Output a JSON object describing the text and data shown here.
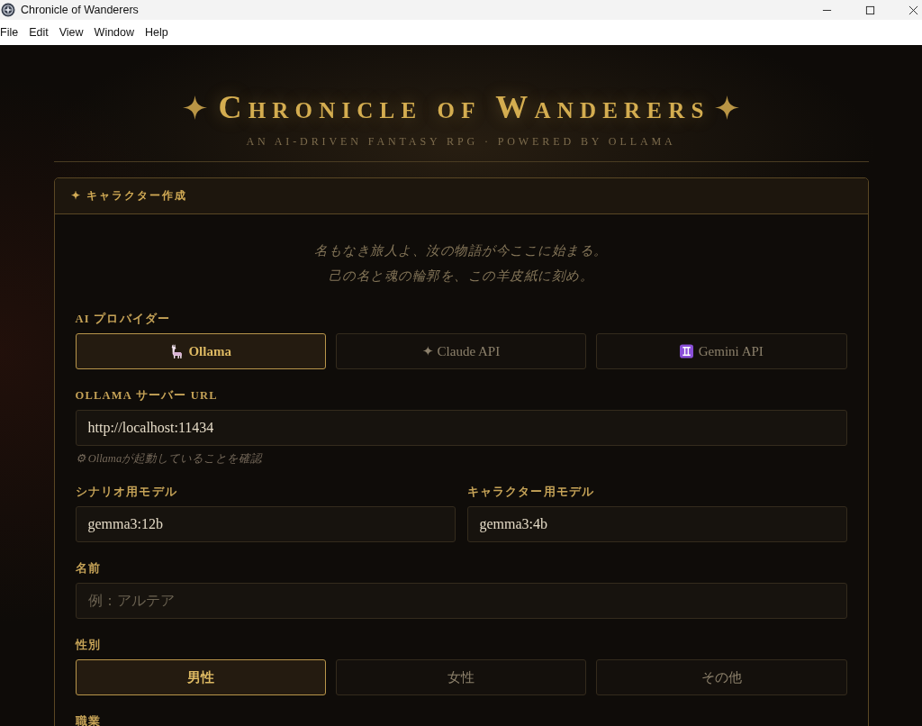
{
  "window": {
    "title": "Chronicle of Wanderers"
  },
  "menu": [
    "File",
    "Edit",
    "View",
    "Window",
    "Help"
  ],
  "header": {
    "title": "Chronicle of Wanderers",
    "subtitle": "AN AI-DRIVEN FANTASY RPG · POWERED BY OLLAMA"
  },
  "panel": {
    "title": "✦ キャラクター作成",
    "intro": [
      "名もなき旅人よ、汝の物語が今ここに始まる。",
      "己の名と魂の輪郭を、この羊皮紙に刻め。"
    ],
    "fields": [
      {
        "kind": "choice",
        "label": "AI プロバイダー",
        "options": [
          {
            "kind": "llama",
            "label": "Ollama",
            "selected": true
          },
          {
            "kind": "plain",
            "label": "✦ Claude API",
            "selected": false
          },
          {
            "kind": "gemini",
            "label": "Gemini API",
            "selected": false
          }
        ]
      },
      {
        "kind": "input",
        "label": "OLLAMA サーバー URL",
        "value": "http://localhost:11434",
        "hint": "⚙ Ollamaが起動していることを確認"
      },
      {
        "kind": "pair",
        "items": [
          {
            "label": "シナリオ用モデル",
            "value": "gemma3:12b"
          },
          {
            "label": "キャラクター用モデル",
            "value": "gemma3:4b"
          }
        ]
      },
      {
        "kind": "input",
        "label": "名前",
        "placeholder": "例：アルテア"
      },
      {
        "kind": "choice",
        "label": "性別",
        "options": [
          {
            "kind": "plain",
            "label": "男性",
            "selected": true
          },
          {
            "kind": "plain",
            "label": "女性",
            "selected": false
          },
          {
            "kind": "plain",
            "label": "その他",
            "selected": false
          }
        ]
      },
      {
        "kind": "heading",
        "label": "職業"
      }
    ]
  }
}
